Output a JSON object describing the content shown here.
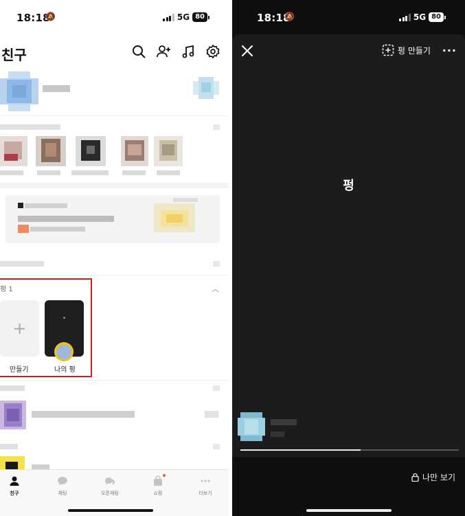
{
  "left": {
    "status": {
      "time": "18:18",
      "network": "5G",
      "battery": "80"
    },
    "header": {
      "title": "친구"
    },
    "icons": [
      "search-icon",
      "add-friend-icon",
      "music-icon",
      "settings-icon"
    ],
    "pyeong_section": {
      "header": "펑 1",
      "add_label": "만들기",
      "add_symbol": "+",
      "mine_label": "나의 펑"
    },
    "highlight_color": "#d21e1e",
    "tabs": [
      {
        "label": "친구",
        "icon": "person-icon",
        "active": true
      },
      {
        "label": "채팅",
        "icon": "chat-icon",
        "active": false
      },
      {
        "label": "오픈채팅",
        "icon": "open-chat-icon",
        "active": false
      },
      {
        "label": "쇼핑",
        "icon": "shopping-bag-icon",
        "active": false
      },
      {
        "label": "더보기",
        "icon": "more-icon",
        "active": false
      }
    ]
  },
  "right": {
    "status": {
      "time": "18:18",
      "network": "5G",
      "battery": "80"
    },
    "make_button": "펑 만들기",
    "more": "···",
    "center_text": "펑",
    "progress": 0.55,
    "only_me": "나만 보기"
  }
}
